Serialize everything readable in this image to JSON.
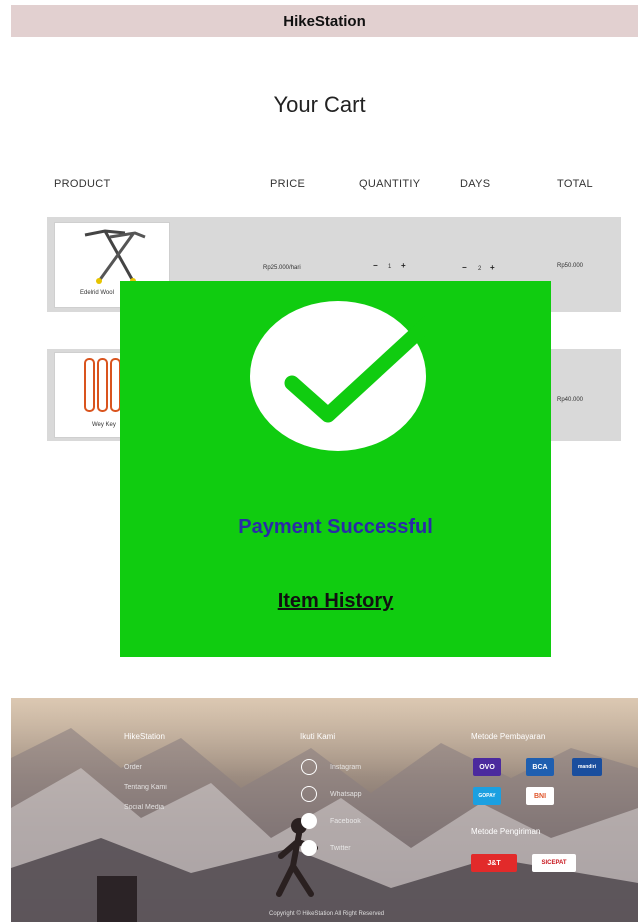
{
  "header": {
    "brand": "HikeStation"
  },
  "cart": {
    "title": "Your Cart",
    "columns": {
      "product": "PRODUCT",
      "price": "PRICE",
      "quantity": "QUANTITIY",
      "days": "DAYS",
      "total": "TOTAL"
    },
    "items": [
      {
        "name": "Edelrid Wool",
        "price": "Rp25.000/hari",
        "quantity": "1",
        "days": "2",
        "total": "Rp50.000"
      },
      {
        "name": "Wey Key",
        "price": "",
        "quantity": "",
        "days": "",
        "total": "Rp40.000"
      }
    ]
  },
  "modal": {
    "message": "Payment Successful",
    "link": "Item History"
  },
  "footer": {
    "brand": "HikeStation",
    "links": [
      "Order",
      "Tentang Kami",
      "Social Media"
    ],
    "follow_title": "Ikuti Kami",
    "socials": [
      "Instagram",
      "Whatsapp",
      "Facebook",
      "Twitter"
    ],
    "payment_title": "Metode Pembayaran",
    "payments": [
      "OVO",
      "BCA",
      "mandiri",
      "GOPAY",
      "BNI"
    ],
    "shipping_title": "Metode Pengiriman",
    "shipping": [
      "J&T",
      "SICEPAT"
    ],
    "copyright": "Copyright © HikeStation All Right Reserved"
  },
  "colors": {
    "modal_bg": "#10cc10",
    "success_text": "#2a2aa8",
    "topbar": "#e2d0d0"
  }
}
